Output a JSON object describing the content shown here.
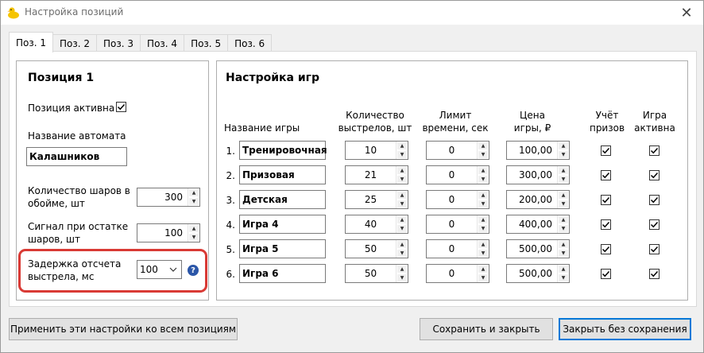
{
  "window": {
    "title": "Настройка позиций",
    "close_label": "✕"
  },
  "tabs": [
    {
      "label": "Поз. 1",
      "active": true
    },
    {
      "label": "Поз. 2",
      "active": false
    },
    {
      "label": "Поз. 3",
      "active": false
    },
    {
      "label": "Поз. 4",
      "active": false
    },
    {
      "label": "Поз. 5",
      "active": false
    },
    {
      "label": "Поз. 6",
      "active": false
    }
  ],
  "position": {
    "title": "Позиция 1",
    "active_label": "Позиция активна",
    "active_checked": true,
    "gun_name_label": "Название автомата",
    "gun_name_value": "Калашников",
    "balls_label": "Количество шаров в обойме, шт",
    "balls_value": "300",
    "signal_label": "Сигнал при остатке шаров, шт",
    "signal_value": "100",
    "delay_label": "Задержка отсчета выстрела, мс",
    "delay_value": "100",
    "help_glyph": "?"
  },
  "games": {
    "title": "Настройка игр",
    "headers": {
      "name": "Название игры",
      "shots": "Количество выстрелов, шт",
      "time": "Лимит времени, сек",
      "price": "Цена игры, ₽",
      "prizes": "Учёт призов",
      "active": "Игра активна"
    },
    "rows": [
      {
        "num": "1.",
        "name": "Тренировочная",
        "shots": "10",
        "time": "0",
        "price": "100,00",
        "prizes": true,
        "active": true
      },
      {
        "num": "2.",
        "name": "Призовая",
        "shots": "21",
        "time": "0",
        "price": "300,00",
        "prizes": true,
        "active": true
      },
      {
        "num": "3.",
        "name": "Детская",
        "shots": "25",
        "time": "0",
        "price": "200,00",
        "prizes": true,
        "active": true
      },
      {
        "num": "4.",
        "name": "Игра 4",
        "shots": "40",
        "time": "0",
        "price": "400,00",
        "prizes": true,
        "active": true
      },
      {
        "num": "5.",
        "name": "Игра 5",
        "shots": "50",
        "time": "0",
        "price": "500,00",
        "prizes": true,
        "active": true
      },
      {
        "num": "6.",
        "name": "Игра 6",
        "shots": "50",
        "time": "0",
        "price": "500,00",
        "prizes": true,
        "active": true
      }
    ]
  },
  "buttons": {
    "apply_all": "Применить эти настройки ко всем позициям",
    "save_close": "Сохранить и закрыть",
    "close_nosave": "Закрыть без сохранения"
  },
  "colors": {
    "accent": "#0078d7",
    "highlight": "#d93a35",
    "help": "#2b56a8"
  }
}
